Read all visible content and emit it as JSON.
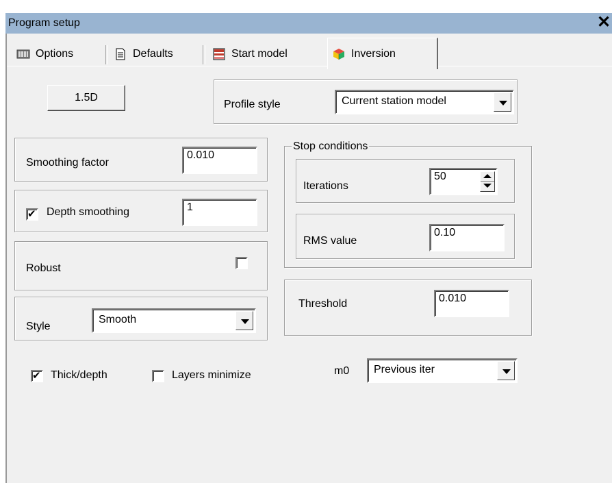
{
  "window": {
    "title": "Program setup",
    "close_glyph": "✕"
  },
  "tabs": [
    {
      "label": "Options",
      "icon": "options-icon"
    },
    {
      "label": "Defaults",
      "icon": "defaults-icon"
    },
    {
      "label": "Start model",
      "icon": "start-model-icon"
    },
    {
      "label": "Inversion",
      "icon": "inversion-icon",
      "active": true
    }
  ],
  "inversion": {
    "mode_button": "1.5D",
    "profile_style": {
      "label": "Profile style",
      "value": "Current station model"
    },
    "smoothing_factor": {
      "label": "Smoothing factor",
      "value": "0.010"
    },
    "depth_smoothing": {
      "label": "Depth smoothing",
      "checked": true,
      "value": "1"
    },
    "robust": {
      "label": "Robust",
      "checked": false
    },
    "style": {
      "label": "Style",
      "value": "Smooth"
    },
    "stop_conditions": {
      "title": "Stop conditions",
      "iterations": {
        "label": "Iterations",
        "value": "50"
      },
      "rms": {
        "label": "RMS value",
        "value": "0.10"
      }
    },
    "threshold": {
      "label": "Threshold",
      "value": "0.010"
    },
    "thick_depth": {
      "label": "Thick/depth",
      "checked": true
    },
    "layers_minimize": {
      "label": "Layers minimize",
      "checked": false
    },
    "m0": {
      "label": "m0",
      "value": "Previous iter"
    }
  },
  "colors": {
    "titlebar": "#99b4d1",
    "face": "#f0f0f0",
    "shadow": "#a0a0a0"
  }
}
